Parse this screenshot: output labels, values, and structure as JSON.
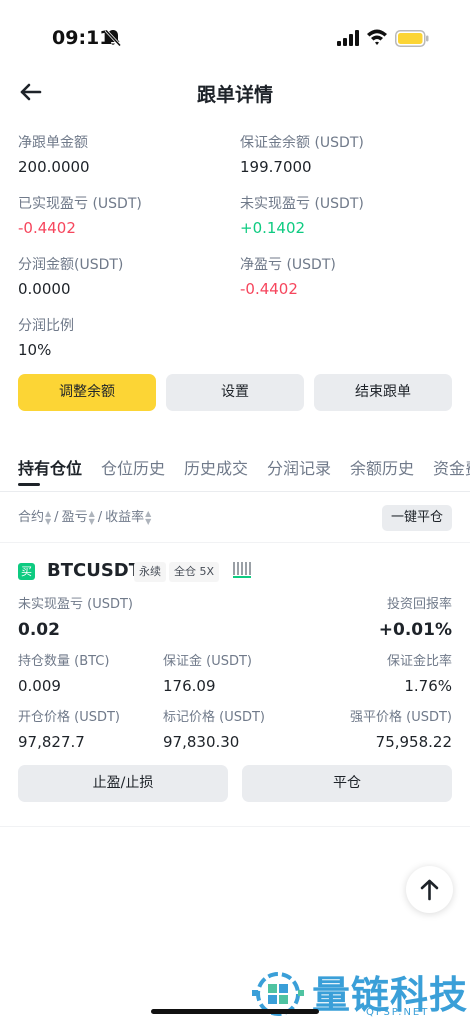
{
  "status_bar": {
    "time": "09:11"
  },
  "header": {
    "title": "跟单详情"
  },
  "summary": [
    {
      "label": "净跟单金额",
      "value": "200.0000",
      "tone": "neutral"
    },
    {
      "label": "保证金余额 (USDT)",
      "value": "199.7000",
      "tone": "neutral"
    },
    {
      "label": "已实现盈亏 (USDT)",
      "value": "-0.4402",
      "tone": "negative"
    },
    {
      "label": "未实现盈亏 (USDT)",
      "value": "+0.1402",
      "tone": "positive"
    },
    {
      "label": "分润金额(USDT)",
      "value": "0.0000",
      "tone": "neutral"
    },
    {
      "label": "净盈亏 (USDT)",
      "value": "-0.4402",
      "tone": "negative"
    },
    {
      "label": "分润比例",
      "value": "10%",
      "tone": "neutral"
    }
  ],
  "actions": {
    "adjust_balance": "调整余额",
    "settings": "设置",
    "end_copy": "结束跟单"
  },
  "tabs": [
    "持有仓位",
    "仓位历史",
    "历史成交",
    "分润记录",
    "余额历史",
    "资金费"
  ],
  "active_tab": 0,
  "sort": {
    "contract": "合约",
    "pnl": "盈亏",
    "roi": "收益率",
    "close_all": "一键平仓"
  },
  "position": {
    "side": "买",
    "symbol": "BTCUSDT",
    "type_tag": "永续",
    "margin_tag": "全仓 5X",
    "unrealized_label": "未实现盈亏 (USDT)",
    "unrealized_value": "0.02",
    "roi_label": "投资回报率",
    "roi_value": "+0.01%",
    "size_label": "持仓数量 (BTC)",
    "size_value": "0.009",
    "margin_label": "保证金 (USDT)",
    "margin_value": "176.09",
    "margin_ratio_label": "保证金比率",
    "margin_ratio_value": "1.76%",
    "entry_label": "开仓价格 (USDT)",
    "entry_value": "97,827.7",
    "mark_label": "标记价格 (USDT)",
    "mark_value": "97,830.30",
    "liq_label": "强平价格 (USDT)",
    "liq_value": "75,958.22",
    "tpsl_button": "止盈/止损",
    "close_button": "平仓"
  },
  "watermark": {
    "text": "量链科技",
    "sub": "QFSP.NET"
  },
  "colors": {
    "accent": "#fcd535",
    "positive": "#0ecb81",
    "negative": "#f6465d",
    "watermark": "#3a9fd8"
  }
}
